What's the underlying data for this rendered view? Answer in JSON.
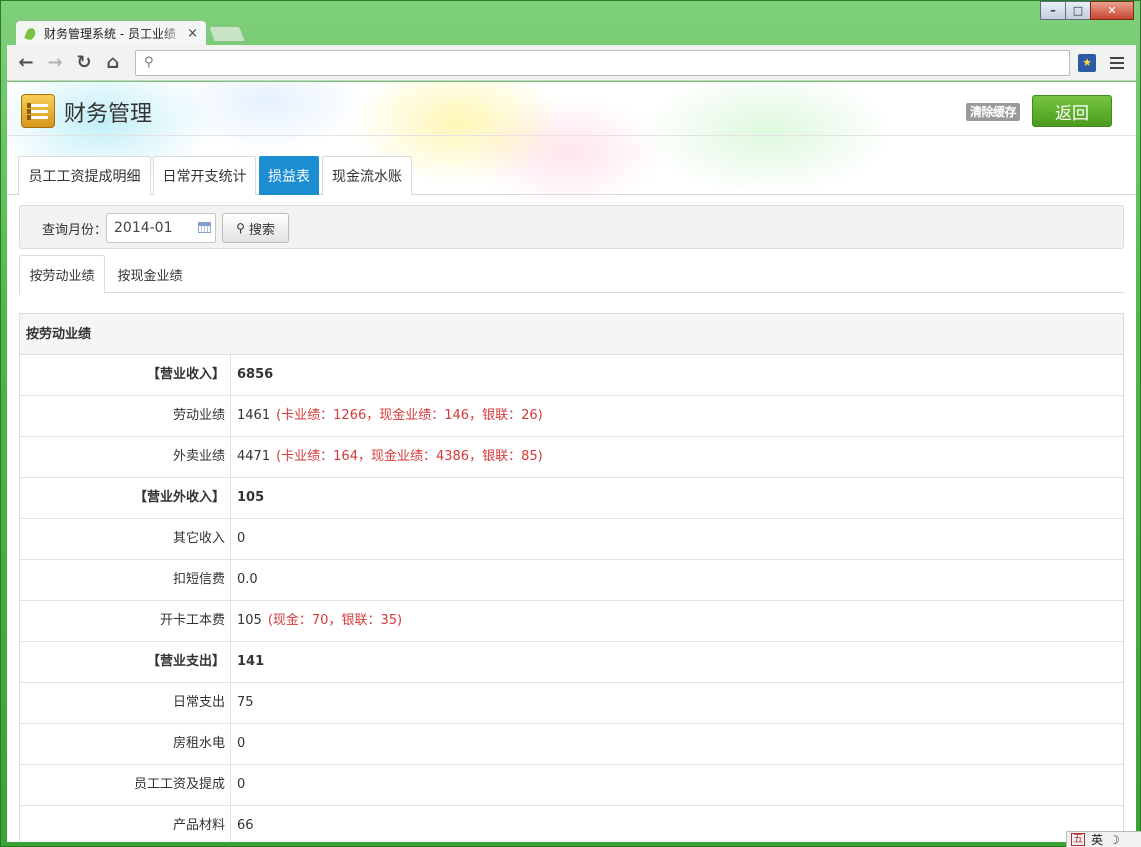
{
  "browser": {
    "tab_title": "财务管理系统 - 员工业绩",
    "tab_close": "×",
    "url": "",
    "window_buttons": {
      "minimize": "–",
      "maximize": "□",
      "close": "✕"
    },
    "nav": {
      "back": "←",
      "forward": "→",
      "reload": "↻",
      "home": "⌂"
    },
    "extension_icon": "★"
  },
  "header": {
    "title": "财务管理",
    "clear_cache_label": "清除缓存",
    "back_label": "返回"
  },
  "main_tabs": [
    {
      "label": "员工工资提成明细",
      "active": false
    },
    {
      "label": "日常开支统计",
      "active": false
    },
    {
      "label": "损益表",
      "active": true
    },
    {
      "label": "现金流水账",
      "active": false
    }
  ],
  "search": {
    "label": "查询月份：",
    "month_value": "2014-01",
    "button_label": "搜索"
  },
  "sub_tabs": [
    {
      "label": "按劳动业绩",
      "active": true
    },
    {
      "label": "按现金业绩",
      "active": false
    }
  ],
  "panel": {
    "title": "按劳动业绩",
    "rows": [
      {
        "label": "【营业收入】",
        "value": "6856",
        "detail": "",
        "section": true
      },
      {
        "label": "劳动业绩",
        "value": "1461",
        "detail": "(卡业绩：1266，现金业绩：146，银联：26)",
        "section": false
      },
      {
        "label": "外卖业绩",
        "value": "4471",
        "detail": "(卡业绩：164，现金业绩：4386，银联：85)",
        "section": false
      },
      {
        "label": "【营业外收入】",
        "value": "105",
        "detail": "",
        "section": true
      },
      {
        "label": "其它收入",
        "value": "0",
        "detail": "",
        "section": false
      },
      {
        "label": "扣短信费",
        "value": "0.0",
        "detail": "",
        "section": false
      },
      {
        "label": "开卡工本费",
        "value": "105",
        "detail": "(现金：70，银联：35)",
        "section": false
      },
      {
        "label": "【营业支出】",
        "value": "141",
        "detail": "",
        "section": true
      },
      {
        "label": "日常支出",
        "value": "75",
        "detail": "",
        "section": false
      },
      {
        "label": "房租水电",
        "value": "0",
        "detail": "",
        "section": false
      },
      {
        "label": "员工工资及提成",
        "value": "0",
        "detail": "",
        "section": false
      },
      {
        "label": "产品材料",
        "value": "66",
        "detail": "",
        "section": false
      }
    ]
  },
  "ime": {
    "mode_glyph": "五",
    "lang": "英",
    "moon": "☽"
  },
  "colors": {
    "accent_tab": "#1a8ed1",
    "back_button": "#5aab2b",
    "detail_red": "#d43a3a",
    "frame_green": "#4db748"
  }
}
